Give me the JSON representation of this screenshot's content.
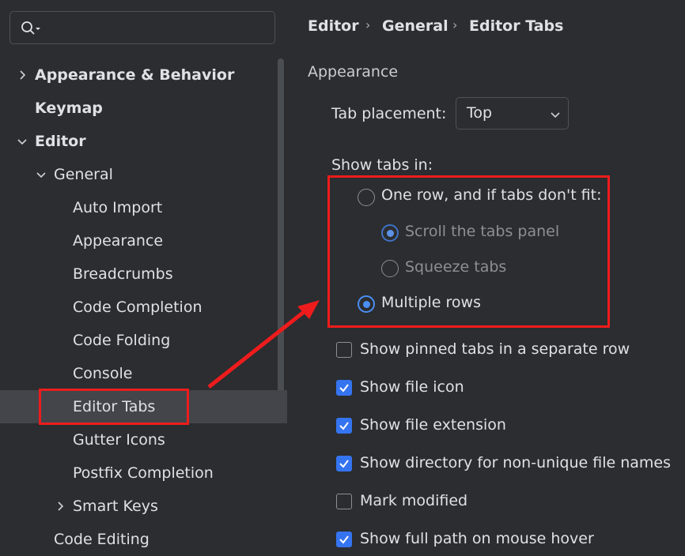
{
  "search": {
    "placeholder": ""
  },
  "sidebar": {
    "items": [
      {
        "label": "Appearance & Behavior",
        "chevron": "right"
      },
      {
        "label": "Keymap"
      },
      {
        "label": "Editor",
        "chevron": "down"
      },
      {
        "label": "General",
        "chevron": "down"
      },
      {
        "label": "Auto Import"
      },
      {
        "label": "Appearance"
      },
      {
        "label": "Breadcrumbs"
      },
      {
        "label": "Code Completion"
      },
      {
        "label": "Code Folding"
      },
      {
        "label": "Console"
      },
      {
        "label": "Editor Tabs",
        "selected": true
      },
      {
        "label": "Gutter Icons"
      },
      {
        "label": "Postfix Completion"
      },
      {
        "label": "Smart Keys",
        "chevron": "right"
      },
      {
        "label": "Code Editing"
      }
    ]
  },
  "breadcrumb": {
    "items": [
      "Editor",
      "General",
      "Editor Tabs"
    ],
    "separator": "›"
  },
  "appearance": {
    "title": "Appearance",
    "tab_placement_label": "Tab placement:",
    "tab_placement_value": "Top"
  },
  "show_tabs": {
    "label": "Show tabs in:",
    "one_row": "One row, and if tabs don't fit:",
    "scroll": "Scroll the tabs panel",
    "squeeze": "Squeeze tabs",
    "multiple": "Multiple rows",
    "selected": "multiple",
    "sub_selected": "scroll"
  },
  "checkboxes": [
    {
      "label": "Show pinned tabs in a separate row",
      "checked": false
    },
    {
      "label": "Show file icon",
      "checked": true
    },
    {
      "label": "Show file extension",
      "checked": true
    },
    {
      "label": "Show directory for non-unique file names",
      "checked": true
    },
    {
      "label": "Mark modified",
      "checked": false
    },
    {
      "label": "Show full path on mouse hover",
      "checked": true
    }
  ],
  "colors": {
    "accent": "#3574f0",
    "highlight": "#ee1c1c",
    "selected_row": "#43454a"
  }
}
